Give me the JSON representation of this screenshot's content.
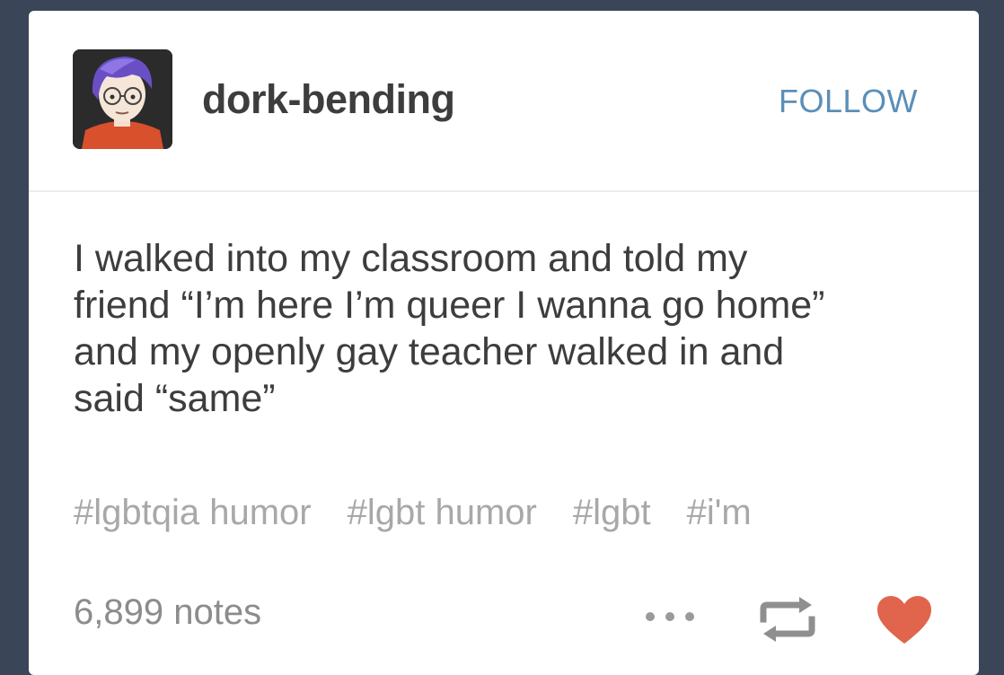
{
  "post": {
    "username": "dork-bending",
    "follow_label": "FOLLOW",
    "body_lines": [
      "I walked into my classroom and told my",
      "friend “I’m here I’m queer I wanna go home”",
      "and my openly gay teacher walked in and",
      "said “same”"
    ],
    "tags": [
      "#lgbtqia humor",
      "#lgbt humor",
      "#lgbt",
      "#i'm"
    ],
    "notes": "6,899 notes"
  },
  "colors": {
    "follow": "#5a8fb8",
    "text": "#3d3d3d",
    "tags": "#a8a8a8",
    "heart": "#e0654c",
    "background": "#3a4558"
  },
  "icons": {
    "avatar": "avatar-illustration",
    "more": "more-dots-icon",
    "reblog": "reblog-icon",
    "like": "heart-icon"
  }
}
